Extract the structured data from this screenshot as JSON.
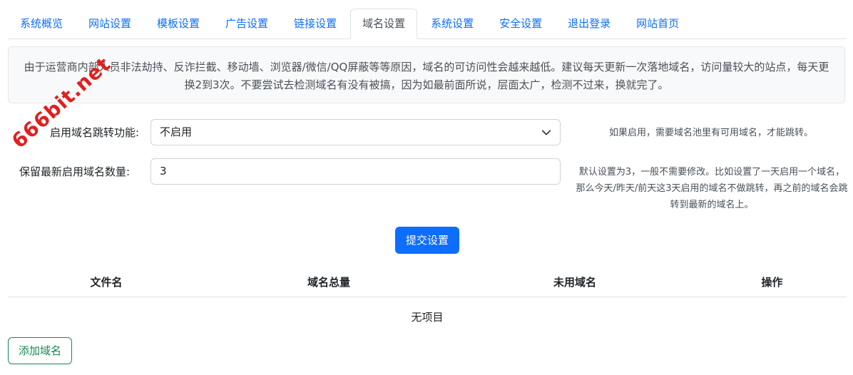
{
  "tabs": [
    {
      "label": "系统概览"
    },
    {
      "label": "网站设置"
    },
    {
      "label": "模板设置"
    },
    {
      "label": "广告设置"
    },
    {
      "label": "链接设置"
    },
    {
      "label": "域名设置"
    },
    {
      "label": "系统设置"
    },
    {
      "label": "安全设置"
    },
    {
      "label": "退出登录"
    },
    {
      "label": "网站首页"
    }
  ],
  "active_tab": "域名设置",
  "notice": {
    "text": "由于运营商内部人员非法劫持、反诈拦截、移动墙、浏览器/微信/QQ屏蔽等等原因，域名的可访问性会越来越低。建议每天更新一次落地域名，访问量较大的站点，每天更换2到3次。不要尝试去检测域名有没有被搞，因为如最前面所说，层面太广，检测不过来，换就完了。"
  },
  "form": {
    "redirect_label": "启用域名跳转功能:",
    "redirect_value": "不启用",
    "redirect_help": "如果启用，需要域名池里有可用域名，才能跳转。",
    "keep_label": "保留最新启用域名数量:",
    "keep_value": "3",
    "keep_help": "默认设置为3，一般不需要修改。比如设置了一天启用一个域名，那么今天/昨天/前天这3天启用的域名不做跳转，再之前的域名会跳转到最新的域名上。"
  },
  "submit_label": "提交设置",
  "table": {
    "headers": [
      "文件名",
      "域名总量",
      "未用域名",
      "操作"
    ],
    "empty_text": "无项目"
  },
  "add_button_label": "添加域名",
  "watermark": "666bit.net",
  "colors": {
    "accent": "#0d6efd",
    "success": "#198754",
    "watermark": "#e02020"
  }
}
